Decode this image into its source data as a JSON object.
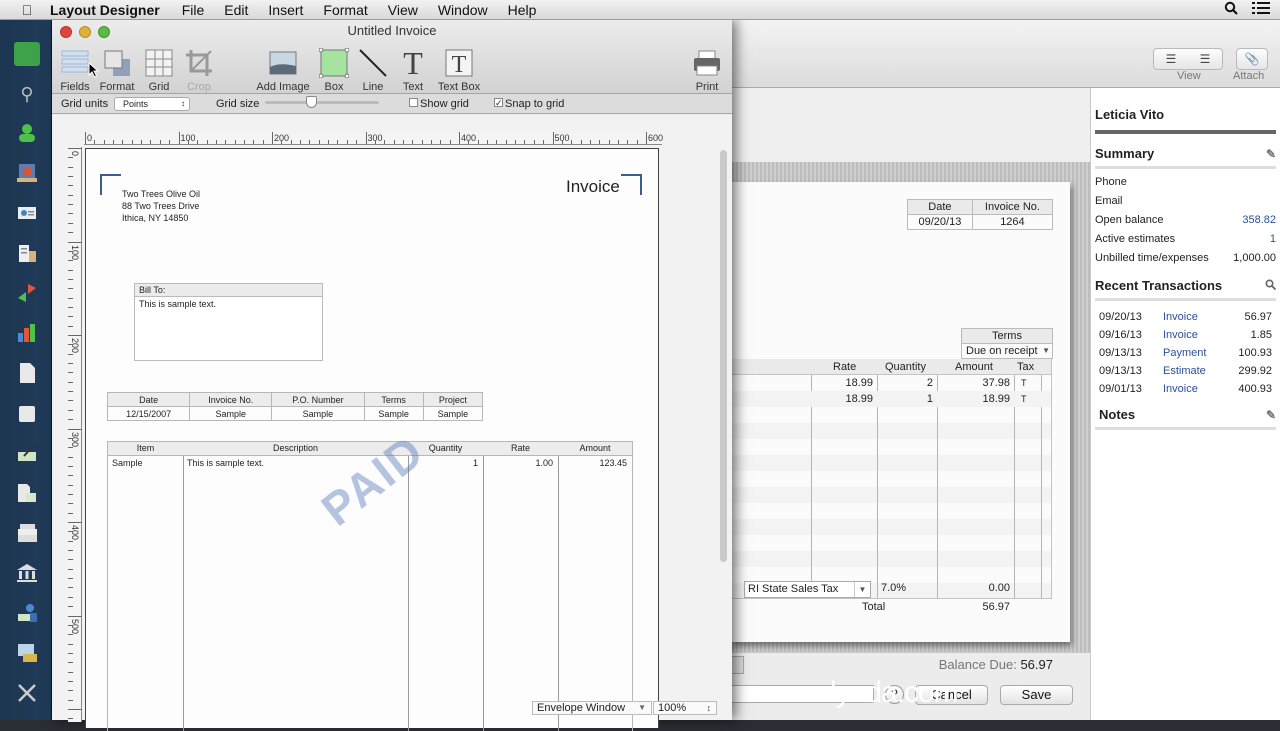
{
  "menubar": {
    "apple": "",
    "app_name": "Layout Designer",
    "items": [
      "File",
      "Edit",
      "Insert",
      "Format",
      "View",
      "Window",
      "Help"
    ],
    "spotlight_icon": "search-icon",
    "list_icon": "notification-list-icon"
  },
  "dock": {
    "items": [
      "home",
      "search",
      "customers",
      "vendors",
      "employees",
      "company",
      "transfers",
      "reports",
      "invoice",
      "estimate",
      "edit-doc",
      "documents",
      "register",
      "bank",
      "users",
      "payroll",
      "tools"
    ]
  },
  "layout_window": {
    "title": "Untitled Invoice",
    "toolbar": {
      "fields": "Fields",
      "format": "Format",
      "grid": "Grid",
      "crop": "Crop",
      "add_image": "Add Image",
      "box": "Box",
      "line": "Line",
      "text": "Text",
      "text_box": "Text Box",
      "print": "Print"
    },
    "options": {
      "grid_units_label": "Grid units",
      "grid_units_value": "Points",
      "grid_size_label": "Grid size",
      "grid_size_value": 0.4,
      "show_grid_label": "Show grid",
      "show_grid_checked": false,
      "snap_label": "Snap to grid",
      "snap_checked": true
    },
    "ruler_h": [
      "0",
      "100",
      "200",
      "300",
      "400",
      "500",
      "600"
    ],
    "ruler_v": [
      "0",
      "100",
      "200",
      "300",
      "400",
      "500"
    ],
    "page": {
      "company_lines": [
        "Two Trees Olive Oil",
        "88 Two Trees Drive",
        "Ithica, NY 14850"
      ],
      "title": "Invoice",
      "bill_to_label": "Bill To:",
      "bill_to_text": "This is sample text.",
      "info_headers": [
        "Date",
        "Invoice No.",
        "P.O. Number",
        "Terms",
        "Project"
      ],
      "info_values": [
        "12/15/2007",
        "Sample",
        "Sample",
        "Sample",
        "Sample"
      ],
      "item_headers": [
        "Item",
        "Description",
        "Quantity",
        "Rate",
        "Amount"
      ],
      "item_row": [
        "Sample",
        "This is sample text.",
        "1",
        "1.00",
        "123.45"
      ],
      "stamp": "PAID"
    },
    "bottom": {
      "envelope": "Envelope Window",
      "zoom": "100%"
    }
  },
  "invoice_window": {
    "toolbar": {
      "view_label": "View",
      "attach_label": "Attach"
    },
    "info_headers": [
      "Date",
      "Invoice No."
    ],
    "info_values": [
      "09/20/13",
      "1264"
    ],
    "terms_label": "Terms",
    "terms_value": "Due on receipt",
    "line_headers": [
      "Rate",
      "Quantity",
      "Amount",
      "Tax"
    ],
    "lines": [
      {
        "rate": "18.99",
        "quantity": "2",
        "amount": "37.98",
        "tax": "T"
      },
      {
        "rate": "18.99",
        "quantity": "1",
        "amount": "18.99",
        "tax": "T"
      }
    ],
    "tax_name": "RI State Sales Tax",
    "tax_rate": "7.0%",
    "tax_amount": "0.00",
    "total_label": "Total",
    "total_value": "56.97",
    "balance_due_label": "Balance Due:",
    "balance_due_value": "56.97",
    "help_label": "?",
    "cancel_label": "Cancel",
    "save_label": "Save"
  },
  "customer_panel": {
    "name": "Leticia Vito",
    "summary_label": "Summary",
    "summary": [
      {
        "label": "Phone",
        "value": ""
      },
      {
        "label": "Email",
        "value": ""
      },
      {
        "label": "Open balance",
        "value": "358.82"
      },
      {
        "label": "Active estimates",
        "value": "1"
      },
      {
        "label": "Unbilled time/expenses",
        "value": "1,000.00"
      }
    ],
    "recent_label": "Recent Transactions",
    "transactions": [
      {
        "date": "09/20/13",
        "type": "Invoice",
        "amount": "56.97"
      },
      {
        "date": "09/16/13",
        "type": "Invoice",
        "amount": "1.85"
      },
      {
        "date": "09/13/13",
        "type": "Payment",
        "amount": "100.93"
      },
      {
        "date": "09/13/13",
        "type": "Estimate",
        "amount": "299.92"
      },
      {
        "date": "09/01/13",
        "type": "Invoice",
        "amount": "400.93"
      }
    ],
    "notes_label": "Notes"
  },
  "watermark": "lynda.com"
}
